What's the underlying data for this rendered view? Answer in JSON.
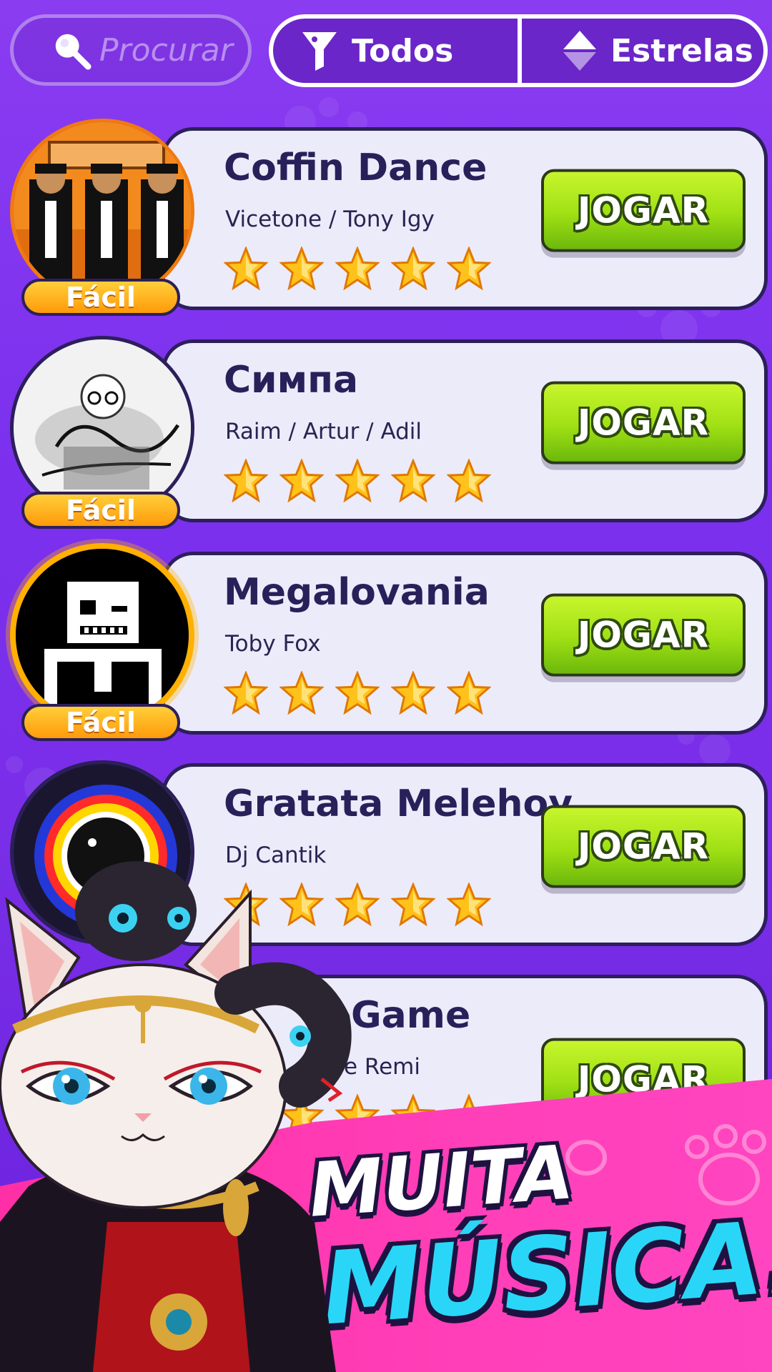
{
  "search": {
    "placeholder": "Procurar",
    "icon": "search-icon"
  },
  "filters": {
    "all_label": "Todos",
    "all_icon": "funnel-icon",
    "sort_label": "Estrelas",
    "sort_icon": "sort-arrows-icon"
  },
  "songs": [
    {
      "title": "Coffin Dance",
      "artist": "Vicetone / Tony Igy",
      "difficulty": "Fácil",
      "stars": 5,
      "play_label": "JOGAR"
    },
    {
      "title": "Симпа",
      "artist": "Raim / Artur / Adil",
      "difficulty": "Fácil",
      "stars": 5,
      "play_label": "JOGAR"
    },
    {
      "title": "Megalovania",
      "artist": "Toby Fox",
      "difficulty": "Fácil",
      "stars": 5,
      "play_label": "JOGAR"
    },
    {
      "title": "Gratata Melehoy",
      "artist": "Dj Cantik",
      "difficulty": "",
      "stars": 5,
      "play_label": "JOGAR"
    },
    {
      "title": "Game",
      "artist": "e Remi",
      "difficulty": "",
      "stars": 5,
      "play_label": "JOGAR"
    }
  ],
  "promo": {
    "line1": "MUITA",
    "line2": "MÚSICA!"
  },
  "colors": {
    "background": "#7b30ee",
    "card": "#ecebfa",
    "play": "#9fe014",
    "badge": "#ff9a0a",
    "banner": "#ff3fb8",
    "accent_text": "#2ad6f7"
  }
}
